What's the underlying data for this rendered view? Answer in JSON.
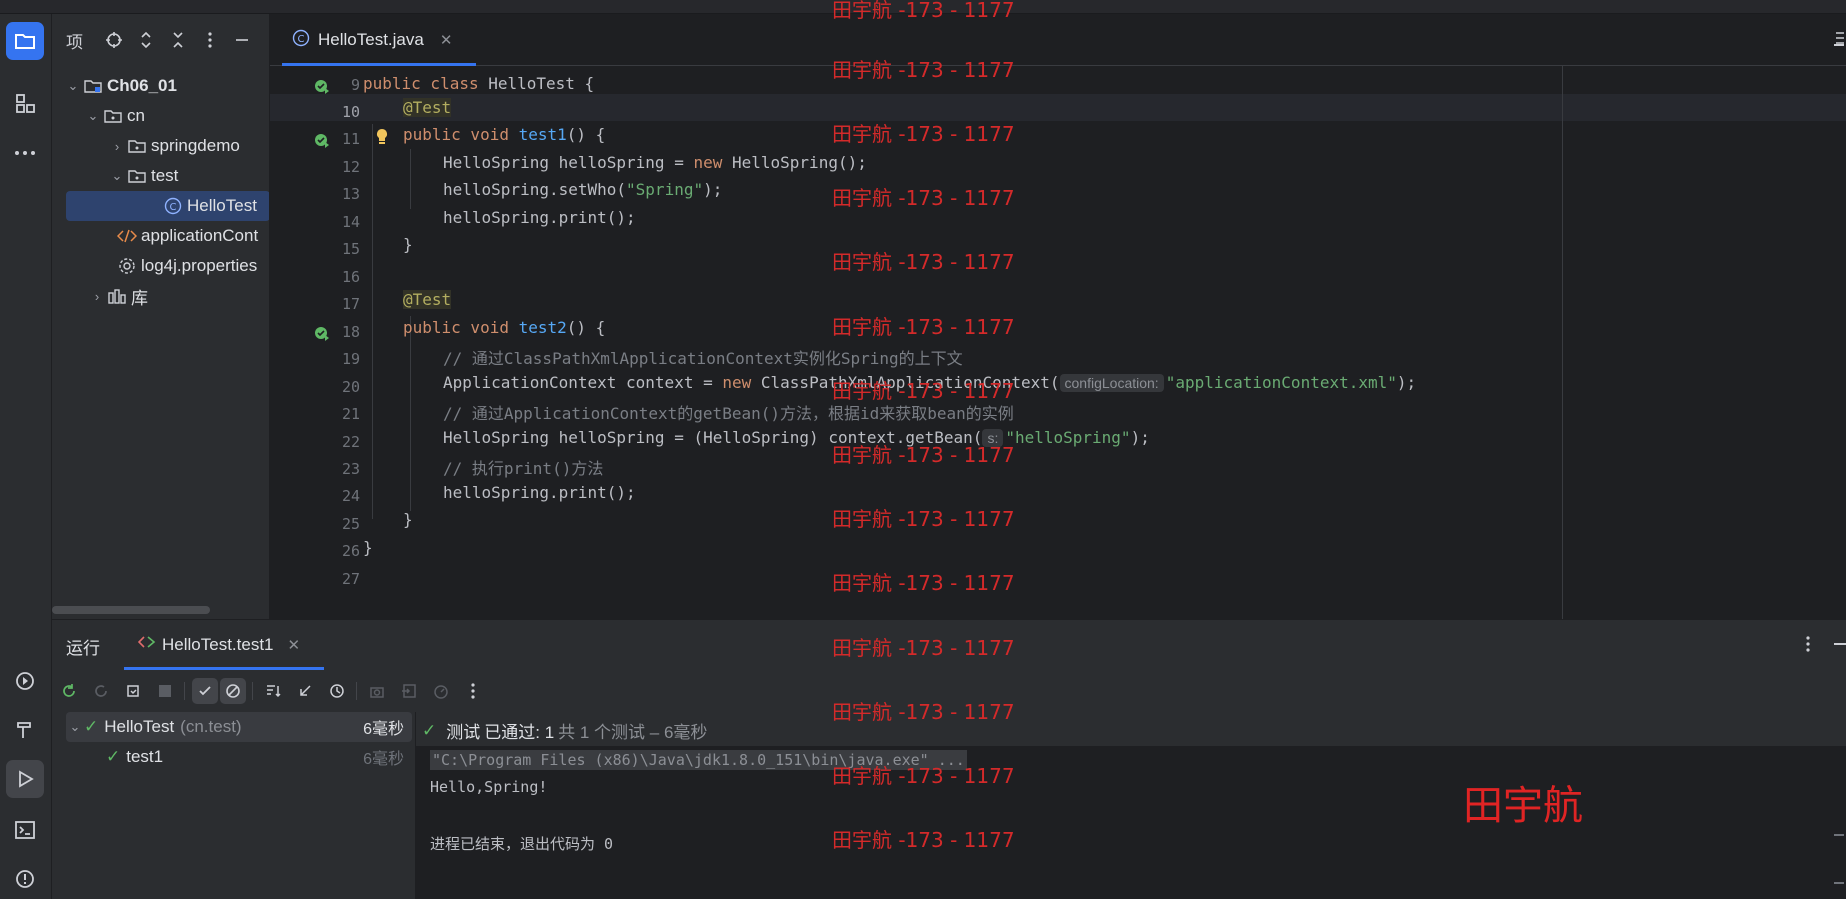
{
  "project": {
    "title": "项",
    "tree": [
      {
        "label": "Ch06_01",
        "bold": true
      },
      {
        "label": "cn"
      },
      {
        "label": "springdemo"
      },
      {
        "label": "test"
      },
      {
        "label": "HelloTest"
      },
      {
        "label": "applicationCont"
      },
      {
        "label": "log4j.properties"
      },
      {
        "label": "库"
      }
    ]
  },
  "editor": {
    "tab_label": "HelloTest.java",
    "line_numbers": [
      "9",
      "10",
      "11",
      "12",
      "13",
      "14",
      "15",
      "16",
      "17",
      "18",
      "19",
      "20",
      "21",
      "22",
      "23",
      "24",
      "25",
      "26",
      "27"
    ],
    "code": {
      "l9a": "public class",
      "l9b": " HelloTest {",
      "l10": "@Test",
      "l11a": "public void ",
      "l11b": "test1",
      "l11c": "() {",
      "l12a": "HelloSpring helloSpring = ",
      "l12b": "new",
      "l12c": " HelloSpring();",
      "l13a": "helloSpring.setWho(",
      "l13b": "\"Spring\"",
      "l13c": ");",
      "l14": "helloSpring.print();",
      "l15": "}",
      "l17": "@Test",
      "l18a": "public void ",
      "l18b": "test2",
      "l18c": "() {",
      "l19": "// 通过ClassPathXmlApplicationContext实例化Spring的上下文",
      "l20a": "ApplicationContext context = ",
      "l20b": "new",
      "l20c": " ClassPathXmlApplicationContext(",
      "l20hint": "configLocation:",
      "l20d": "\"applicationContext.xml\"",
      "l20e": ");",
      "l21": "// 通过ApplicationContext的getBean()方法，根据id来获取bean的实例",
      "l22a": "HelloSpring helloSpring = (HelloSpring) context.getBean(",
      "l22hint": "s:",
      "l22b": "\"helloSpring\"",
      "l22c": ");",
      "l23": "// 执行print()方法",
      "l24": "helloSpring.print();",
      "l25": "}",
      "l26": "}"
    }
  },
  "run": {
    "title": "运行",
    "tab_label": "HelloTest.test1",
    "tests": {
      "root_label": "HelloTest",
      "root_pkg": "(cn.test)",
      "root_time": "6毫秒",
      "child_label": "test1",
      "child_time": "6毫秒"
    },
    "status": {
      "prefix": "测试",
      "passed": "已通过: 1",
      "detail": "共 1 个测试 – 6毫秒"
    },
    "console": [
      "\"C:\\Program Files (x86)\\Java\\jdk1.8.0_151\\bin\\java.exe\" ...",
      "Hello,Spring!",
      "",
      "进程已结束，退出代码为 0"
    ]
  },
  "author_name": "田宇航",
  "watermark": "田宇航 -173 - 1177",
  "colors": {
    "accent": "#3574f0",
    "watermark": "#d42a2a",
    "pass": "#5fb865"
  }
}
